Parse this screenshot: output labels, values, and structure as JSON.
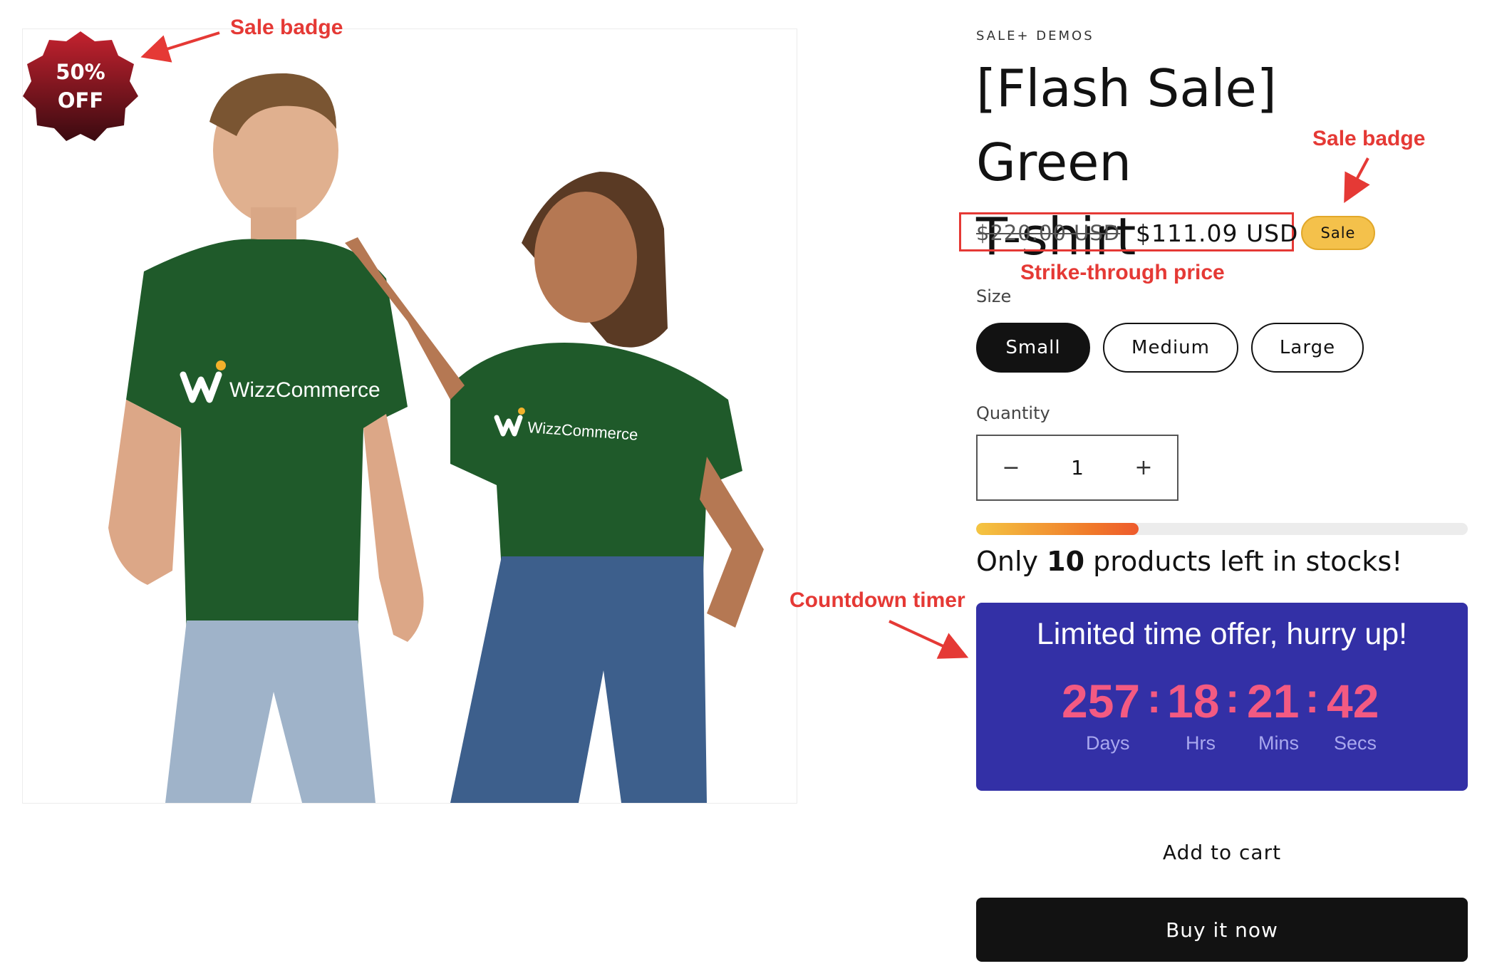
{
  "media": {
    "brand_on_shirt": "WizzCommerce",
    "corner_badge": {
      "line1": "50%",
      "line2": "OFF",
      "color": "#a01521"
    },
    "shirt_color": "#1f5a2a"
  },
  "annotations": {
    "sale_badge_left": "Sale badge",
    "sale_badge_right": "Sale badge",
    "strike_through": "Strike-through price",
    "countdown": "Countdown timer",
    "color": "#e53935"
  },
  "product": {
    "vendor": "SALE+ DEMOS",
    "title_line1": "[Flash Sale] Green",
    "title_line2": "T-shirt",
    "price_old": "$220.00 USD",
    "price_new": "$111.09 USD",
    "sale_pill": "Sale",
    "size_label": "Size",
    "sizes": [
      {
        "label": "Small",
        "selected": true
      },
      {
        "label": "Medium",
        "selected": false
      },
      {
        "label": "Large",
        "selected": false
      }
    ],
    "quantity_label": "Quantity",
    "quantity_value": "1",
    "minus_icon": "−",
    "plus_icon": "+",
    "stock": {
      "prefix": "Only ",
      "count": "10",
      "suffix": " products left in stocks!",
      "fill_fraction": 0.33
    },
    "timer": {
      "title": "Limited time offer, hurry up!",
      "days": "257",
      "hours": "18",
      "minutes": "21",
      "seconds": "42",
      "days_label": "Days",
      "hours_label": "Hrs",
      "mins_label": "Mins",
      "secs_label": "Secs",
      "background": "#3330a6",
      "digit_color": "#f35a82"
    },
    "add_to_cart": "Add to cart",
    "buy_now": "Buy it now"
  }
}
